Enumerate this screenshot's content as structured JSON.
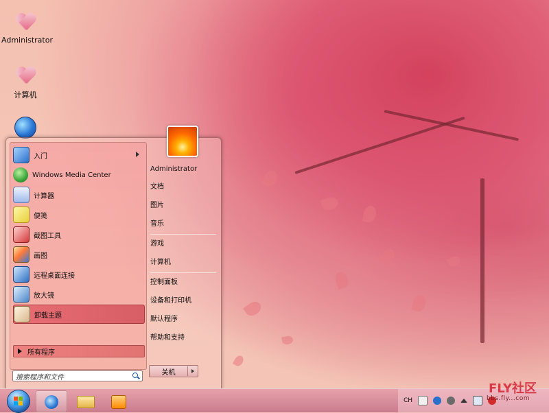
{
  "desktop": {
    "icons": [
      {
        "label": "Administrator",
        "icon": "user-folder-heart-icon"
      },
      {
        "label": "计算机",
        "icon": "computer-heart-icon"
      },
      {
        "label": "",
        "icon": "network-globe-icon"
      }
    ]
  },
  "start_menu": {
    "left_items": [
      {
        "label": "入门",
        "icon": "getting-started-icon",
        "has_submenu": true
      },
      {
        "label": "Windows Media Center",
        "icon": "media-center-icon"
      },
      {
        "label": "计算器",
        "icon": "calculator-icon"
      },
      {
        "label": "便笺",
        "icon": "sticky-notes-icon"
      },
      {
        "label": "截图工具",
        "icon": "snipping-tool-icon"
      },
      {
        "label": "画图",
        "icon": "paint-icon"
      },
      {
        "label": "远程桌面连接",
        "icon": "remote-desktop-icon"
      },
      {
        "label": "放大镜",
        "icon": "magnifier-icon"
      },
      {
        "label": "卸载主题",
        "icon": "uninstall-theme-icon",
        "selected": true
      }
    ],
    "all_programs_label": "所有程序",
    "search_placeholder": "搜索程序和文件",
    "right_items": [
      {
        "label": "Administrator"
      },
      {
        "label": "文档"
      },
      {
        "label": "图片"
      },
      {
        "label": "音乐"
      },
      {
        "label": "游戏"
      },
      {
        "label": "计算机"
      },
      {
        "label": "控制面板"
      },
      {
        "label": "设备和打印机"
      },
      {
        "label": "默认程序"
      },
      {
        "label": "帮助和支持"
      }
    ],
    "shutdown_label": "关机"
  },
  "taskbar": {
    "pinned": [
      {
        "name": "internet-explorer",
        "icon": "internet-explorer-icon",
        "active": true
      },
      {
        "name": "windows-explorer",
        "icon": "folder-icon"
      },
      {
        "name": "media-player",
        "icon": "media-player-icon"
      }
    ],
    "tray": {
      "language": "CH"
    }
  },
  "watermark": {
    "brand": "FLY社区",
    "url": "bbs.fly...com"
  },
  "colors": {
    "wallpaper_base": "#f3c1b2",
    "blossom": "#d23c5a",
    "menu_selected": "#e0646e"
  }
}
